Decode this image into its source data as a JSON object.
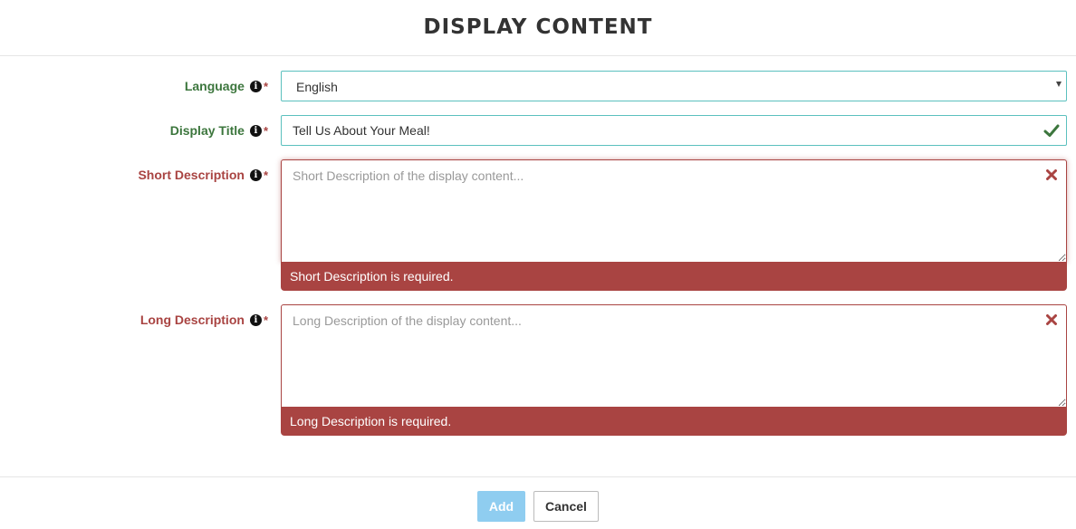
{
  "header": {
    "title": "DISPLAY CONTENT"
  },
  "form": {
    "language": {
      "label": "Language",
      "required_mark": "*",
      "value": "English"
    },
    "display_title": {
      "label": "Display Title",
      "required_mark": "*",
      "value": "Tell Us About Your Meal!"
    },
    "short_description": {
      "label": "Short Description",
      "required_mark": "*",
      "placeholder": "Short Description of the display content...",
      "error": "Short Description is required."
    },
    "long_description": {
      "label": "Long Description",
      "required_mark": "*",
      "placeholder": "Long Description of the display content...",
      "error": "Long Description is required."
    },
    "info_glyph": "i"
  },
  "footer": {
    "add_label": "Add",
    "cancel_label": "Cancel"
  },
  "colors": {
    "valid_label": "#3c763d",
    "error": "#a94442",
    "valid_border": "#5bc0be",
    "add_button": "#8fcdf0"
  },
  "icons": {
    "info": "info-circle-icon",
    "valid": "checkmark-icon",
    "invalid": "x-mark-icon",
    "dropdown": "caret-down-icon"
  }
}
